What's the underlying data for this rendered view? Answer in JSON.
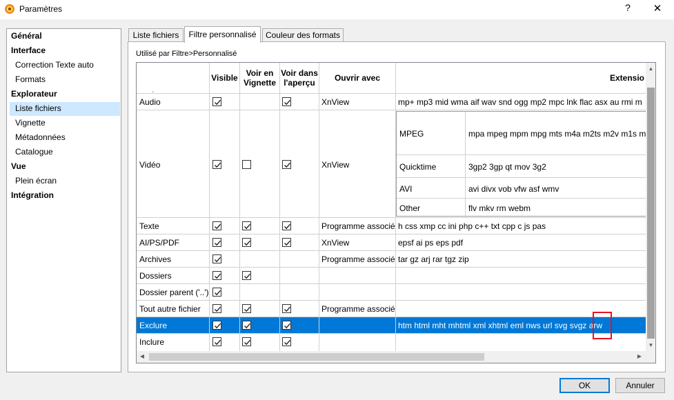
{
  "window": {
    "title": "Paramètres",
    "help_glyph": "?",
    "close_glyph": "✕"
  },
  "sidebar": {
    "items": [
      {
        "label": "Général",
        "bold": true
      },
      {
        "label": "Interface",
        "bold": true
      },
      {
        "label": "Correction Texte auto",
        "bold": false
      },
      {
        "label": "Formats",
        "bold": false
      },
      {
        "label": "Explorateur",
        "bold": true
      },
      {
        "label": "Liste fichiers",
        "bold": false,
        "selected": true
      },
      {
        "label": "Vignette",
        "bold": false
      },
      {
        "label": "Métadonnées",
        "bold": false
      },
      {
        "label": "Catalogue",
        "bold": false
      },
      {
        "label": "Vue",
        "bold": true
      },
      {
        "label": "Plein écran",
        "bold": false
      },
      {
        "label": "Intégration",
        "bold": true
      }
    ]
  },
  "tabs": [
    {
      "label": "Liste fichiers",
      "active": false
    },
    {
      "label": "Filtre personnalisé",
      "active": true
    },
    {
      "label": "Couleur des formats",
      "active": false
    }
  ],
  "used_by": "Utilisé par Filtre>Personnalisé",
  "table": {
    "headers": {
      "name": "",
      "visible": "Visible",
      "vignette": "Voir en Vignette",
      "apercu": "Voir dans l'aperçu",
      "ouvrir": "Ouvrir avec",
      "extensions": "Extensio"
    },
    "sort_indicator": "‸",
    "rows": [
      {
        "name": "Audio",
        "visible": true,
        "vignette": null,
        "apercu": true,
        "ouvrir": "XnView",
        "extensions": "mp+ mp3 mid wma aif wav snd ogg mp2 mpc lnk flac asx au rmi m",
        "selected": false
      },
      {
        "name": "Vidéo",
        "visible": true,
        "vignette": false,
        "apercu": true,
        "ouvrir": "XnView",
        "extensions": "",
        "selected": false
      },
      {
        "name": "Texte",
        "visible": true,
        "vignette": true,
        "apercu": true,
        "ouvrir": "Programme associé",
        "extensions": "h css xmp cc ini php c++ txt cpp c js pas",
        "selected": false
      },
      {
        "name": "AI/PS/PDF",
        "visible": true,
        "vignette": true,
        "apercu": true,
        "ouvrir": "XnView",
        "extensions": "epsf ai ps eps pdf",
        "selected": false
      },
      {
        "name": "Archives",
        "visible": true,
        "vignette": null,
        "apercu": null,
        "ouvrir": "Programme associé",
        "extensions": "tar gz arj rar tgz zip",
        "selected": false
      },
      {
        "name": "Dossiers",
        "visible": true,
        "vignette": true,
        "apercu": null,
        "ouvrir": "",
        "extensions": "",
        "selected": false
      },
      {
        "name": "Dossier parent ('..')",
        "visible": true,
        "vignette": null,
        "apercu": null,
        "ouvrir": "",
        "extensions": "",
        "selected": false
      },
      {
        "name": "Tout autre fichier",
        "visible": true,
        "vignette": true,
        "apercu": true,
        "ouvrir": "Programme associé",
        "extensions": "",
        "selected": false
      },
      {
        "name": "Exclure",
        "visible": true,
        "vignette": true,
        "apercu": true,
        "ouvrir": "",
        "extensions": "htm html mht mhtml xml xhtml eml nws url svg svgz arw",
        "selected": true
      },
      {
        "name": "Inclure",
        "visible": true,
        "vignette": true,
        "apercu": true,
        "ouvrir": "",
        "extensions": "",
        "selected": false
      }
    ],
    "video_subtable": [
      {
        "type": "MPEG",
        "extensions": "mpa mpeg mpm mpg mts m4a m2ts m2v m1s m"
      },
      {
        "type": "Quicktime",
        "extensions": "3gp2 3gp qt mov 3g2"
      },
      {
        "type": "AVI",
        "extensions": "avi divx vob vfw asf wmv"
      },
      {
        "type": "Other",
        "extensions": "flv mkv rm webm"
      }
    ]
  },
  "buttons": {
    "ok": "OK",
    "cancel": "Annuler"
  },
  "colors": {
    "selection": "#0078d7",
    "sidebar_selection": "#cde8ff",
    "highlight_box": "#e81123"
  }
}
